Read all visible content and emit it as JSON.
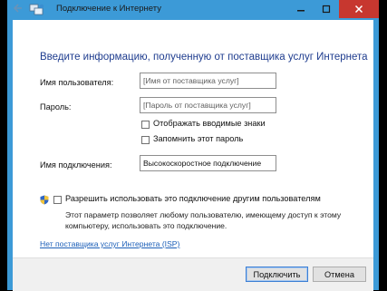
{
  "window": {
    "title": "Подключение к Интернету"
  },
  "form": {
    "heading": "Введите информацию, полученную от поставщика услуг Интернета",
    "username_label": "Имя пользователя:",
    "username_placeholder": "[Имя от поставщика услуг]",
    "password_label": "Пароль:",
    "password_placeholder": "[Пароль от поставщика услуг]",
    "show_chars_label": "Отображать вводимые знаки",
    "remember_password_label": "Запомнить этот пароль",
    "connection_name_label": "Имя подключения:",
    "connection_name_value": "Высокоскоростное подключение",
    "allow_others_label": "Разрешить использовать это подключение другим пользователям",
    "allow_others_description_line1": "Этот параметр позволяет любому пользователю, имеющему доступ к этому",
    "allow_others_description_line2": "компьютеру, использовать это подключение.",
    "no_isp_link": "Нет поставщика услуг Интернета (ISP)"
  },
  "footer": {
    "connect_label": "Подключить",
    "cancel_label": "Отмена"
  },
  "colors": {
    "frame": "#3c9ad7",
    "close_button": "#c7372f",
    "heading": "#1f3d8f",
    "link": "#1c5fb8"
  },
  "icons": [
    "back-arrow-icon",
    "network-icon",
    "minimize-icon",
    "maximize-icon",
    "close-icon",
    "uac-shield-icon"
  ]
}
